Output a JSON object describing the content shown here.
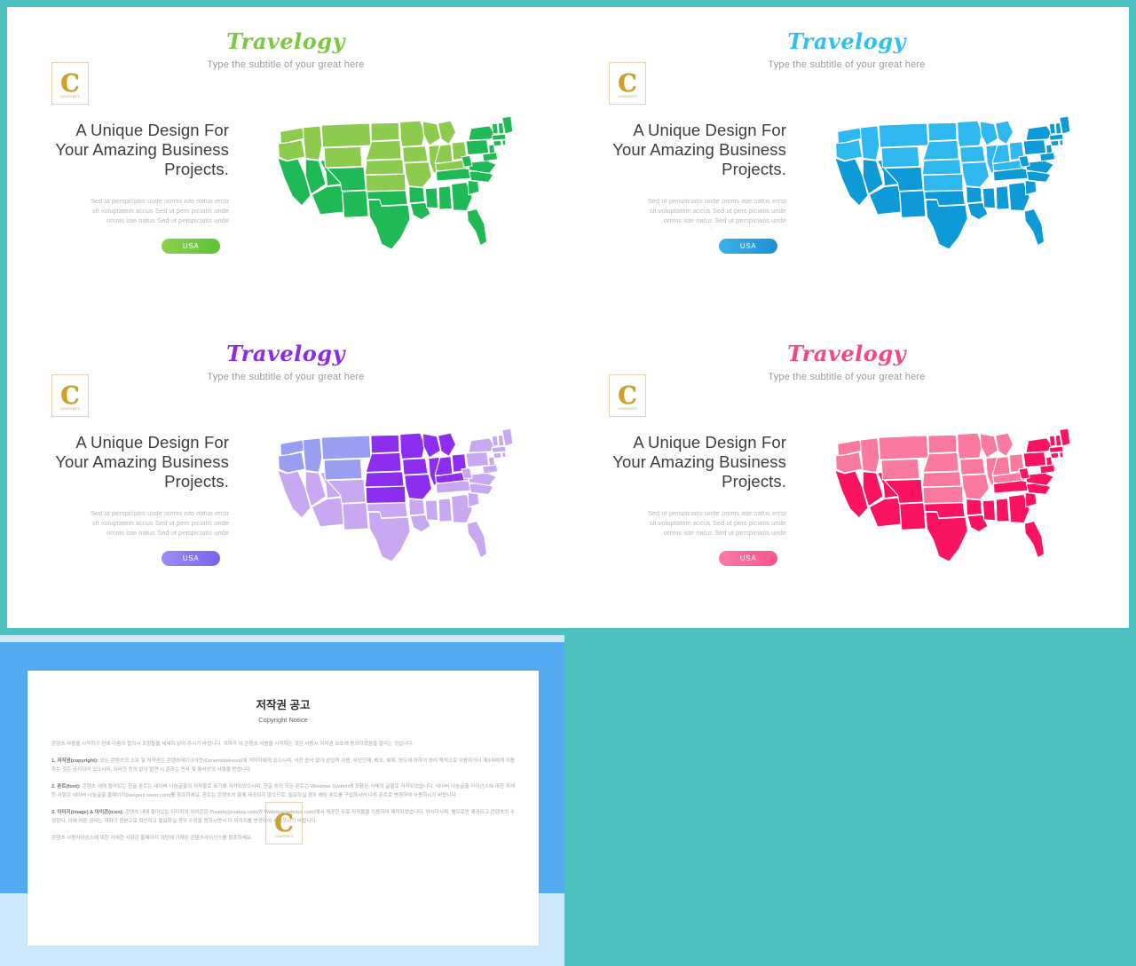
{
  "theme": {
    "background": "#4cc1c0",
    "card_background": "#ffffff"
  },
  "common": {
    "logo_text": "Travelogy",
    "subtitle": "Type the subtitle of your great here",
    "headline": "A Unique Design For Your Amazing Business Projects.",
    "body_line1": "Sed ut perspiciatis unde omnis iste natus error",
    "body_line2": "sit voluptatem accus Sed ut pers piciatis unde",
    "body_line3": "omnis iste natus Sed ut perspiciatis unde",
    "button_label": "USA",
    "watermark_letter": "C",
    "watermark_sub": "CONTENTS"
  },
  "slides": [
    {
      "id": "slide-green",
      "accent": "#2ecc5f",
      "logo_color": "#7ac943",
      "button_gradient_from": "#8fd14f",
      "button_gradient_to": "#5bc236",
      "map_light": "#8dcb4f",
      "map_dark": "#1fb955",
      "map_stroke": "#ffffff"
    },
    {
      "id": "slide-blue",
      "accent": "#1aa3e0",
      "logo_color": "#2ec2f0",
      "button_gradient_from": "#3bb0e8",
      "button_gradient_to": "#1f8fd6",
      "map_light": "#2fb7ef",
      "map_dark": "#0e9ad6",
      "map_stroke": "#ffffff"
    },
    {
      "id": "slide-purple",
      "accent": "#7a3df0",
      "logo_color": "#8b2ae8",
      "button_gradient_from": "#9b8cf5",
      "button_gradient_to": "#7b63ee",
      "map_light": "#c9a8f2",
      "map_dark": "#8c2df0",
      "map_mid": "#9a9ef0",
      "map_stroke": "#ffffff"
    },
    {
      "id": "slide-pink",
      "accent": "#f8317a",
      "logo_color": "#f5487f",
      "button_gradient_from": "#fb7aa6",
      "button_gradient_to": "#f8558d",
      "map_light": "#f9799f",
      "map_dark": "#fa1360",
      "map_stroke": "#ffffff"
    }
  ],
  "copyright": {
    "title": "저작권 공고",
    "subtitle": "Copyright Notice",
    "paragraphs": [
      {
        "lead": "",
        "text": "콘텐츠 사용을 시작하기 전에 다음의 합의서 조항들을 세세히 읽어 주시기 바랍니다. 귀하가 이 콘텐츠 사용을 시작하는 것은 사용시 저작권 보호에 동의하셨음을 알리는 것입니다."
      },
      {
        "lead": "1. 저작권(copyright):",
        "text": "모든 콘텐츠의 소유 및 저작권은 콘텐츠테이크아웃(Contentstakeout)에 저작자에게 있으시며, 사전 승낙 없이 상업적 이용, 무단전재, 배포, 복제, 양도에 의하여 영리 목적으로 이용하거나 제3자에게 이용하는 것은 금지되어 있으시며, 이러한 동의 없이 발견 시 준하는 민사 및 형사상의 사항을 받습니다."
      },
      {
        "lead": "2. 폰트(font):",
        "text": "콘텐츠 내에 들어있는 한글 폰트는 네이버 나눔글꼴의 저작물로 표기에 저작되었으시며, 한글 외의 모든 폰트는 Windows System에 포함된 서체의 글꼴로 저작되었습니다. 네이버 나눔글꼴 라이선스에 대한 자세한 사항은 네이버 나눔글꼴 홈페이지(hangeul.naver.com)를 참조하세요. 폰트는 콘텐츠의 함께 제공되지 않으므로, 필요하실 경우 해당 폰트를 구입하시어 다른 폰트로 변경하여 사용하시기 바랍니다."
      },
      {
        "lead": "3. 이미지(image) & 아이콘(icon):",
        "text": "콘텐츠 내에 들어있는 이미지와 아이콘은 Pixabay(pixabay.com)와 Webolys(webolys.com)에서 제공한 무료 저작물을 이용하여 제작되었습니다. 아시다시피, 별도로만 제공되고 콘텐츠의 수정한다, 이에 따른 권리는 귀하가 원본으로 확인하고 필요하실 경우 수정을 원하시면서 다 이미지를 변경하여 사용하시기 바랍니다."
      },
      {
        "lead": "",
        "text": "콘텐츠 사용라이선스에 대한 자세한 사항은 홈페이지 하단에 기재된 콘텐츠라이선스를 참조하세요."
      }
    ]
  }
}
